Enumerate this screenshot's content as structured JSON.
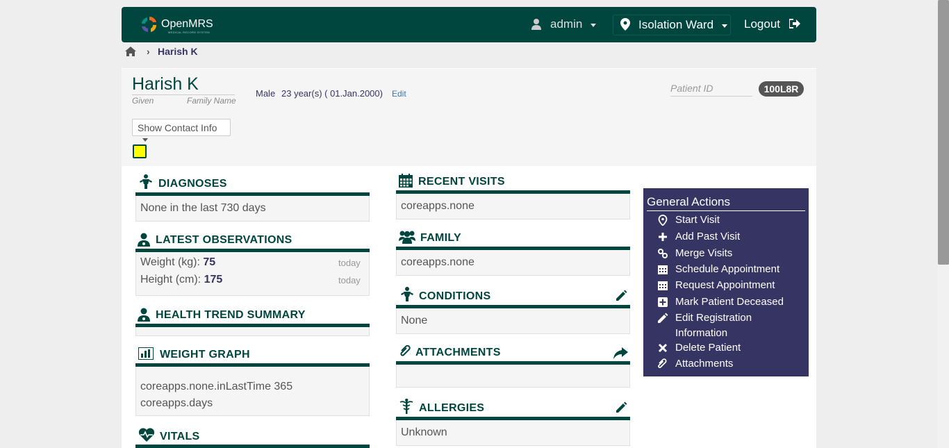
{
  "header": {
    "brand": "OpenMRS",
    "brand_sub": "MEDICAL RECORD SYSTEM",
    "user": "admin",
    "location": "Isolation Ward",
    "logout": "Logout"
  },
  "breadcrumb": {
    "patient": "Harish K"
  },
  "patient": {
    "name": "Harish K",
    "given_label": "Given",
    "family_label": "Family Name",
    "gender": "Male",
    "age_dob": "23 year(s) ( 01.Jan.2000)",
    "edit": "Edit",
    "contact_btn": "Show Contact Info",
    "id_label": "Patient ID",
    "id_value": "100L8R"
  },
  "widgets": {
    "diagnoses": {
      "title": "DIAGNOSES",
      "body": "None in the last 730 days"
    },
    "latest_obs": {
      "title": "LATEST OBSERVATIONS",
      "rows": [
        {
          "label": "Weight (kg): ",
          "value": "75",
          "when": "today"
        },
        {
          "label": "Height (cm): ",
          "value": "175",
          "when": "today"
        }
      ]
    },
    "health_trend": {
      "title": "HEALTH TREND SUMMARY"
    },
    "weight_graph": {
      "title": "WEIGHT GRAPH",
      "line1": "coreapps.none.inLastTime 365",
      "line2": "coreapps.days"
    },
    "vitals": {
      "title": "VITALS"
    },
    "recent_visits": {
      "title": "RECENT VISITS",
      "body": "coreapps.none"
    },
    "family": {
      "title": "FAMILY",
      "body": "coreapps.none"
    },
    "conditions": {
      "title": "CONDITIONS",
      "body": "None"
    },
    "attachments": {
      "title": "ATTACHMENTS"
    },
    "allergies": {
      "title": "ALLERGIES",
      "body": "Unknown"
    }
  },
  "general_actions": {
    "title": "General Actions",
    "items": [
      "Start Visit",
      "Add Past Visit",
      "Merge Visits",
      "Schedule Appointment",
      "Request Appointment",
      "Mark Patient Deceased",
      "Edit Registration",
      "Information",
      "Delete Patient",
      "Attachments"
    ]
  },
  "colors": {
    "primary": "#00463f",
    "actions_bg": "#363463",
    "badge": "#555555",
    "sticky": "#ffff00"
  }
}
